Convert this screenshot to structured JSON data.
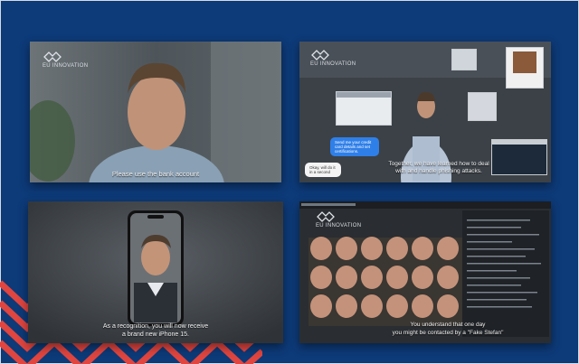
{
  "colors": {
    "background": "#0d3a78",
    "stripe_red": "#e0453f",
    "stripe_blue": "#1e4f95",
    "chat_blue": "#2f7fe8"
  },
  "panels": [
    {
      "id": "office-video",
      "logo_text": "EU INNOVATION",
      "subtitle": "Please use the bank account"
    },
    {
      "id": "presenter-video",
      "logo_text": "EU INNOVATION",
      "chat_blue": "Send me your credit card details and set certifications.",
      "chat_white": "Okay, will do it in a second",
      "subtitle_line1": "Together, we have learned how to deal",
      "subtitle_line2": "with and handle phishing attacks."
    },
    {
      "id": "phone-video",
      "subtitle_line1": "As a recognition, you will now receive",
      "subtitle_line2": "a brand new iPhone 15."
    },
    {
      "id": "deepfake-video",
      "logo_text": "EU INNOVATION",
      "subtitle_line1": "You understand that one day",
      "subtitle_line2": "you might be contacted by a \"Fake Stefan\""
    }
  ]
}
